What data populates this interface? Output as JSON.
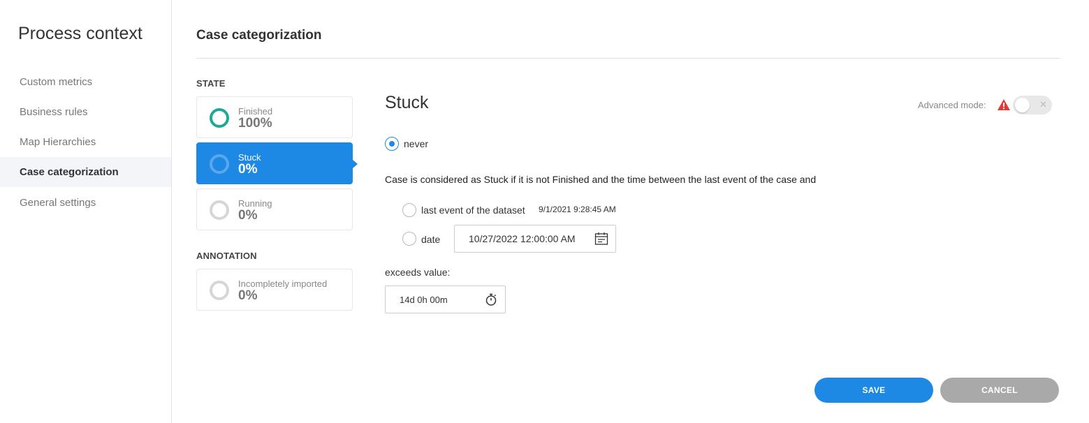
{
  "sidebar": {
    "title": "Process context",
    "items": [
      {
        "label": "Custom metrics"
      },
      {
        "label": "Business rules"
      },
      {
        "label": "Map Hierarchies"
      },
      {
        "label": "Case categorization"
      },
      {
        "label": "General settings"
      }
    ],
    "active_index": 3
  },
  "page": {
    "title": "Case categorization"
  },
  "state": {
    "section_label": "STATE",
    "cards": [
      {
        "name": "Finished",
        "value": "100%"
      },
      {
        "name": "Stuck",
        "value": "0%"
      },
      {
        "name": "Running",
        "value": "0%"
      }
    ],
    "selected_index": 1
  },
  "annotation": {
    "section_label": "ANNOTATION",
    "cards": [
      {
        "name": "Incompletely imported",
        "value": "0%"
      }
    ]
  },
  "detail": {
    "title": "Stuck",
    "advanced_mode_label": "Advanced mode:",
    "advanced_mode_enabled": false,
    "never_label": "never",
    "never_checked": true,
    "sentence": "Case is considered as Stuck if it is not Finished and the time between the last event of the case and",
    "last_event_label": "last event of the dataset",
    "last_event_value": "9/1/2021 9:28:45 AM",
    "date_label": "date",
    "date_value": "10/27/2022 12:00:00 AM",
    "exceeds_label": "exceeds value:",
    "exceeds_value": "14d 0h 00m"
  },
  "buttons": {
    "save": "SAVE",
    "cancel": "CANCEL"
  },
  "colors": {
    "accent": "#1e88e5",
    "finished_ring": "#1ea896",
    "warning": "#e53935",
    "cancel_bg": "#a9a9a9"
  }
}
